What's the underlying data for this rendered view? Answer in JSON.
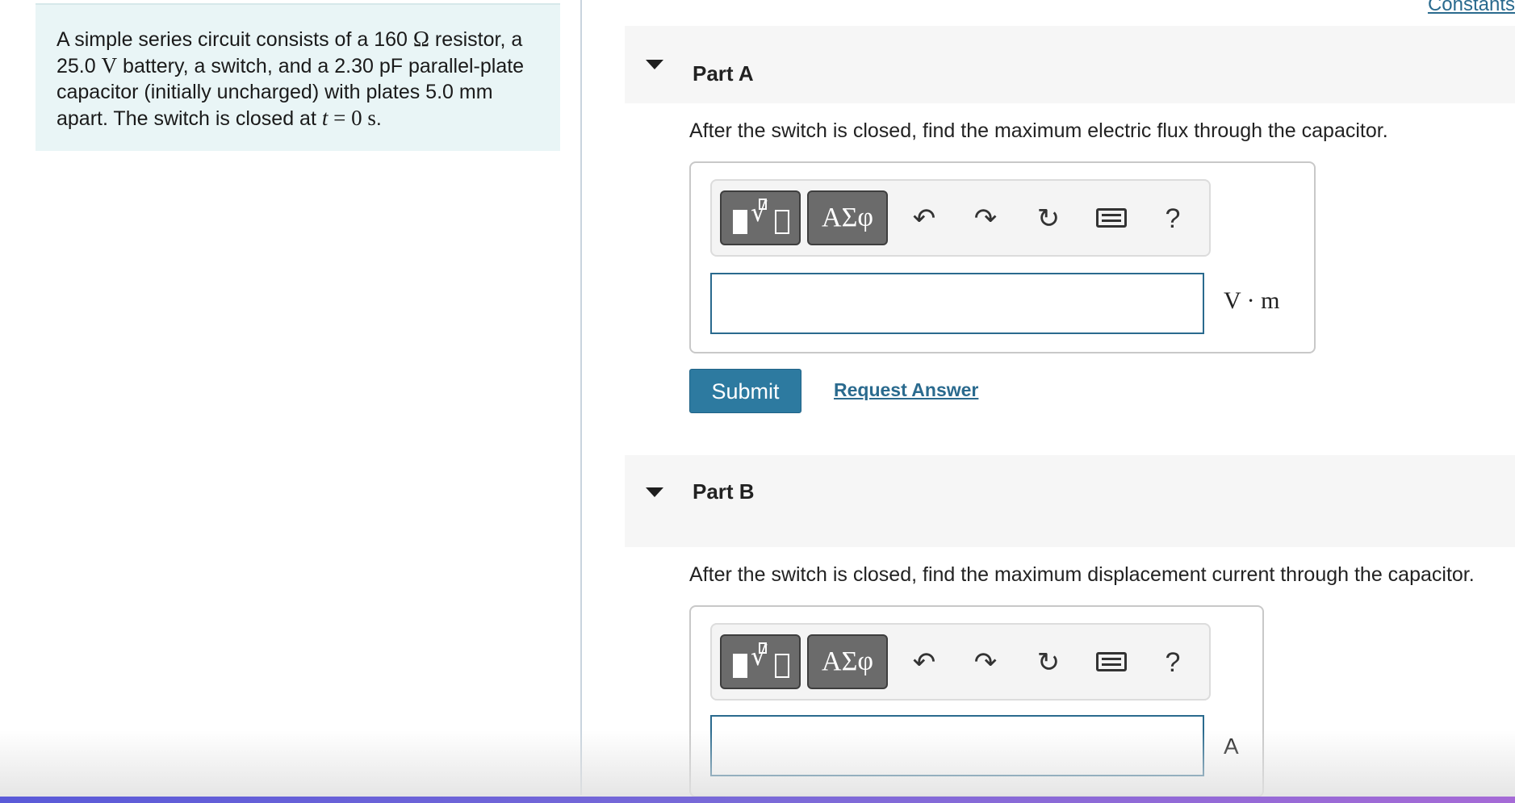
{
  "problem": {
    "text_1": "A simple series circuit consists of a 160 ",
    "unit_ohm": "Ω",
    "text_2": " resistor, a 25.0 ",
    "unit_volt": "V",
    "text_3": " battery, a switch, and a 2.30 pF parallel-plate capacitor (initially uncharged) with plates 5.0 mm apart. The switch is closed at ",
    "var_t": "t",
    "equals": " = ",
    "time_value": "0 s",
    "text_end": "."
  },
  "header": {
    "constants_link": "Constants"
  },
  "part_a": {
    "title": "Part A",
    "question": "After the switch is closed, find the maximum electric flux through the capacitor.",
    "unit": "V · m",
    "input_value": ""
  },
  "part_b": {
    "title": "Part B",
    "question": "After the switch is closed, find the maximum displacement current through the capacitor.",
    "unit": "A",
    "input_value": ""
  },
  "toolbar": {
    "symbols_label": "ΑΣφ",
    "undo_glyph": "↶",
    "redo_glyph": "↷",
    "reset_glyph": "↻",
    "help_label": "?",
    "icons": [
      "templates-icon",
      "undo-icon",
      "redo-icon",
      "reset-icon",
      "keyboard-icon",
      "help-icon"
    ]
  },
  "actions": {
    "submit_label": "Submit",
    "request_answer_label": "Request Answer"
  },
  "colors": {
    "problem_bg": "#e9f5f6",
    "accent": "#2d7aa0",
    "link": "#2a6a8e",
    "part_bar_bg": "#f6f6f6"
  }
}
